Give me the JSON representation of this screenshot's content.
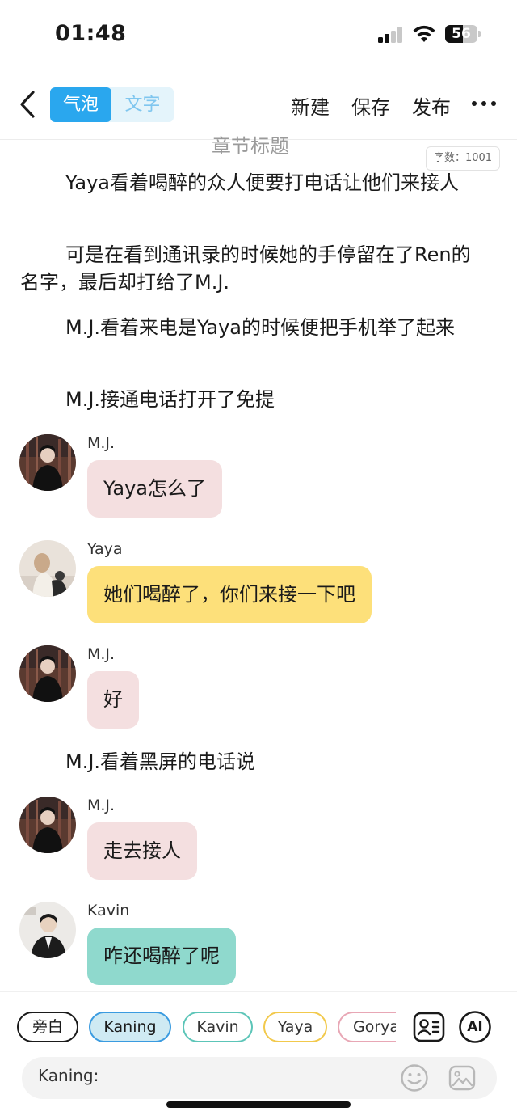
{
  "status_bar": {
    "time": "01:48",
    "battery_level": "56",
    "battery_fraction": 0.56,
    "signal_bars_active": 2,
    "signal_bars_total": 4
  },
  "nav": {
    "back_icon": "chevron-left-icon",
    "segment_bubble": "气泡",
    "segment_text": "文字",
    "new_label": "新建",
    "save_label": "保存",
    "publish_label": "发布",
    "more_icon": "more-dots-icon",
    "accent_color": "#2aa7ee"
  },
  "editor": {
    "chapter_title": "章节标题",
    "word_count": "字数：1001",
    "paragraphs": [
      "Yaya看着喝醉的众人便要打电话让他们来接人",
      "可是在看到通讯录的时候她的手停留在了Ren的名字，最后却打给了M.J.",
      "M.J.看着来电是Yaya的时候便把手机举了起来",
      "M.J.接通电话打开了免提",
      "M.J.看着黑屏的电话说"
    ],
    "messages": [
      {
        "sender": "M.J.",
        "text": "Yaya怎么了",
        "bubble_color": "#f4dfe0"
      },
      {
        "sender": "Yaya",
        "text": "她们喝醉了，你们来接一下吧",
        "bubble_color": "#fde07a"
      },
      {
        "sender": "M.J.",
        "text": "好",
        "bubble_color": "#f4dfe0"
      },
      {
        "sender": "M.J.",
        "text": "走去接人",
        "bubble_color": "#f4dfe0"
      },
      {
        "sender": "Kavin",
        "text": "咋还喝醉了呢",
        "bubble_color": "#8fd9cd"
      }
    ]
  },
  "bottom": {
    "characters": [
      {
        "label": "旁白",
        "color": "#1a1a1a",
        "selected": false
      },
      {
        "label": "Kaning",
        "color": "#3a9be0",
        "selected": true
      },
      {
        "label": "Kavin",
        "color": "#5cc5b8",
        "selected": false
      },
      {
        "label": "Yaya",
        "color": "#f2c94c",
        "selected": false
      },
      {
        "label": "Gorya",
        "color": "#e8a7b5",
        "selected": false
      }
    ],
    "role_card_icon": "role-card-icon",
    "ai_label": "AI",
    "input_prefix": "Kaning:",
    "emoji_icon": "emoji-icon",
    "image_icon": "image-icon"
  }
}
